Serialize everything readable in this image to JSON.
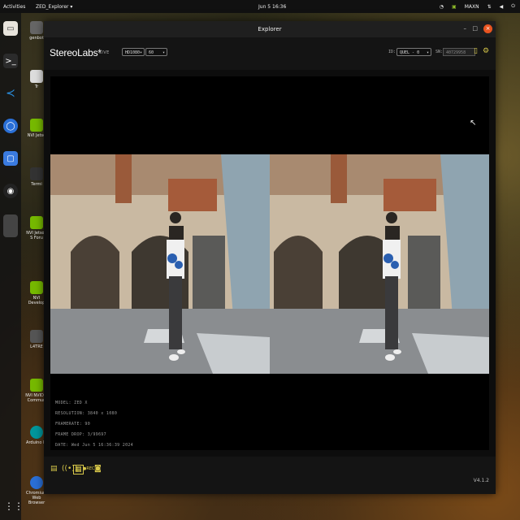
{
  "topbar": {
    "activities": "Activities",
    "app_menu": "ZED_Explorer ▾",
    "clock": "Jun 5  16:36",
    "tray_label": "MAXN"
  },
  "desktop": {
    "icons": [
      "genbot",
      "Tr",
      "NVI Jetso",
      "Termi",
      "NVI Jetson S Foru",
      "NVI Develop",
      "L4TRE",
      "NVI NVIDIA Commun",
      "Arduino IC",
      "Chromium Web Browser"
    ]
  },
  "window": {
    "title": "Explorer",
    "controls": {
      "minimize": "–",
      "maximize": "□",
      "close": "×"
    }
  },
  "appbar": {
    "logo": "StereoLabs*",
    "mode": "LIVE",
    "resolution_select": "HD1080",
    "fps_select": "60",
    "id_label": "ID:",
    "id_select": "QUEL - 0",
    "sn_label": "SN:",
    "sn_value": "40729958"
  },
  "metadata": {
    "model": "MODEL: ZED X",
    "resolution": "RESOLUTION: 3840 x 1080",
    "framerate": "FRAMERATE: 90",
    "frame_drop": "FRAME DROP: 3/99697",
    "date": "DATE: Wed Jun 5 16:36:39 2024"
  },
  "footer": {
    "rec_label": "●REC",
    "version": "V4.1.2"
  },
  "colors": {
    "accent": "#d8c84a",
    "close": "#e95420",
    "nvidia": "#8fbc2a"
  }
}
